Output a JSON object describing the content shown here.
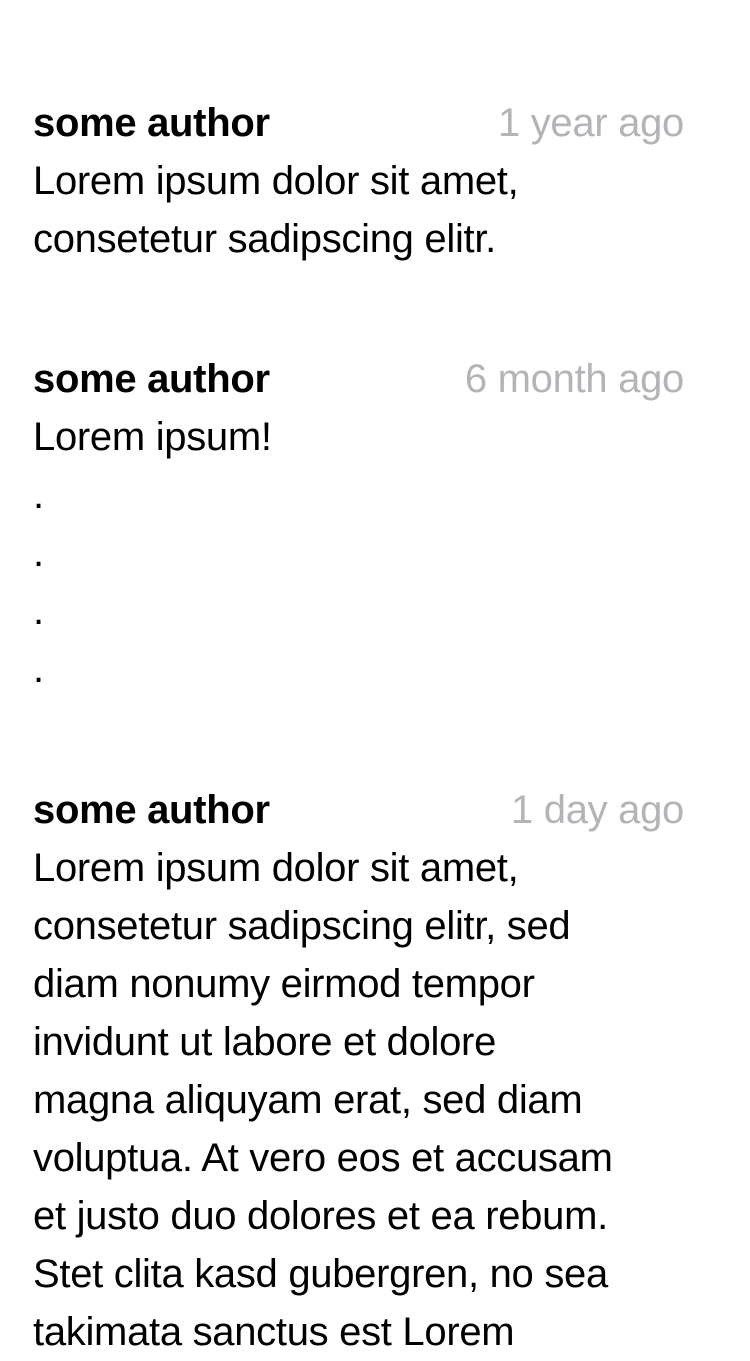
{
  "comments": [
    {
      "author": "some author",
      "time": "1 year ago",
      "text": "Lorem ipsum dolor sit amet,\nconsetetur sadipscing elitr."
    },
    {
      "author": "some author",
      "time": "6 month ago",
      "text": "Lorem ipsum!\n.\n.\n.\n."
    },
    {
      "author": "some author",
      "time": "1 day ago",
      "text": "Lorem ipsum dolor sit amet,\nconsetetur sadipscing elitr, sed\ndiam nonumy eirmod tempor\ninvidunt ut labore et dolore\nmagna aliquyam erat, sed diam\nvoluptua. At vero eos et accusam\net justo duo dolores et ea rebum.\nStet clita kasd gubergren, no sea\ntakimata sanctus est Lorem"
    }
  ],
  "colors": {
    "text": "#000000",
    "timestamp": "#b3b3b8",
    "background": "#ffffff"
  }
}
